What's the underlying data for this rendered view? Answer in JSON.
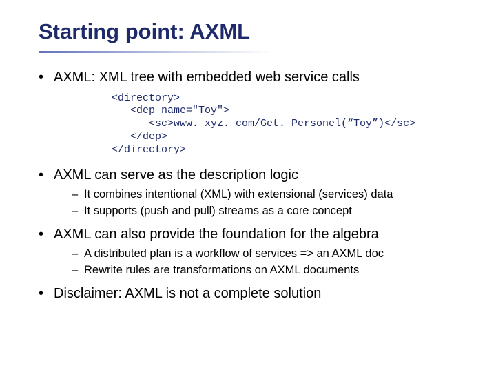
{
  "title": "Starting point: AXML",
  "bullets": [
    {
      "text": "AXML: XML tree with embedded web service calls",
      "code": "<directory>\n   <dep name=\"Toy\">\n      <sc>www. xyz. com/Get. Personel(“Toy”)</sc>\n   </dep>\n</directory>"
    },
    {
      "text": "AXML can serve as the description logic",
      "sub": [
        "It combines intentional (XML) with extensional (services) data",
        "It supports (push and pull) streams as a core concept"
      ]
    },
    {
      "text": "AXML can also provide the foundation for the algebra",
      "sub": [
        "A distributed plan is a workflow of services => an AXML doc",
        "Rewrite rules are transformations on AXML documents"
      ]
    },
    {
      "text": "Disclaimer: AXML is not a complete solution"
    }
  ]
}
